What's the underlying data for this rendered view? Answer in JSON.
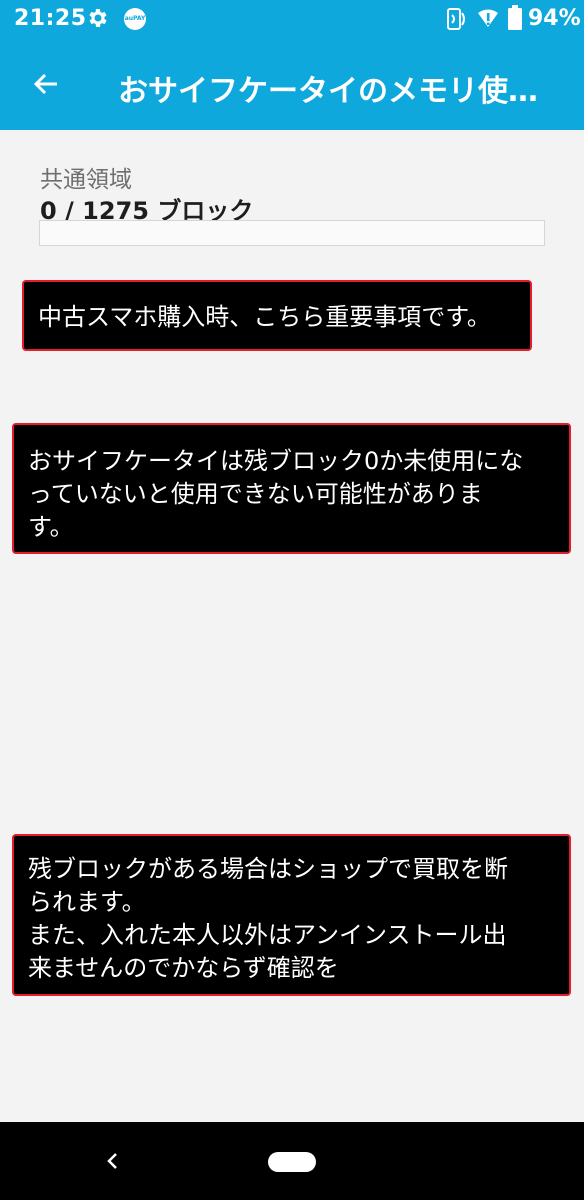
{
  "status_bar": {
    "time": "21:25",
    "gear_icon": "gear-icon",
    "app_icon_text": "auPAY",
    "nfc_icon": "nfc-icon",
    "signal_icon": "signal-icon",
    "battery_icon": "battery-icon",
    "battery_percent": "94%"
  },
  "toolbar": {
    "back_icon": "back-arrow-icon",
    "title": "おサイフケータイのメモリ使用状況"
  },
  "memory": {
    "section_label": "共通領域",
    "block_count": "0 / 1275 ブロック",
    "used_fraction": 0
  },
  "notes": {
    "note1": [
      "中古スマホ購入時、こちら重要事項です。"
    ],
    "note2": [
      "おサイフケータイは残ブロック0か未使用にな",
      "っていないと使用できない可能性がありま",
      "す。"
    ],
    "note3": [
      "残ブロックがある場合はショップで買取を断",
      "られます。",
      "また、入れた本人以外はアンインストール出",
      "来ませんのでかならず確認を"
    ]
  },
  "nav_bar": {
    "back_icon": "nav-back-icon",
    "home_icon": "nav-home-pill"
  },
  "colors": {
    "accent": "#0ea8dd",
    "note_border": "#e31d2b",
    "background": "#f3f3f3"
  }
}
